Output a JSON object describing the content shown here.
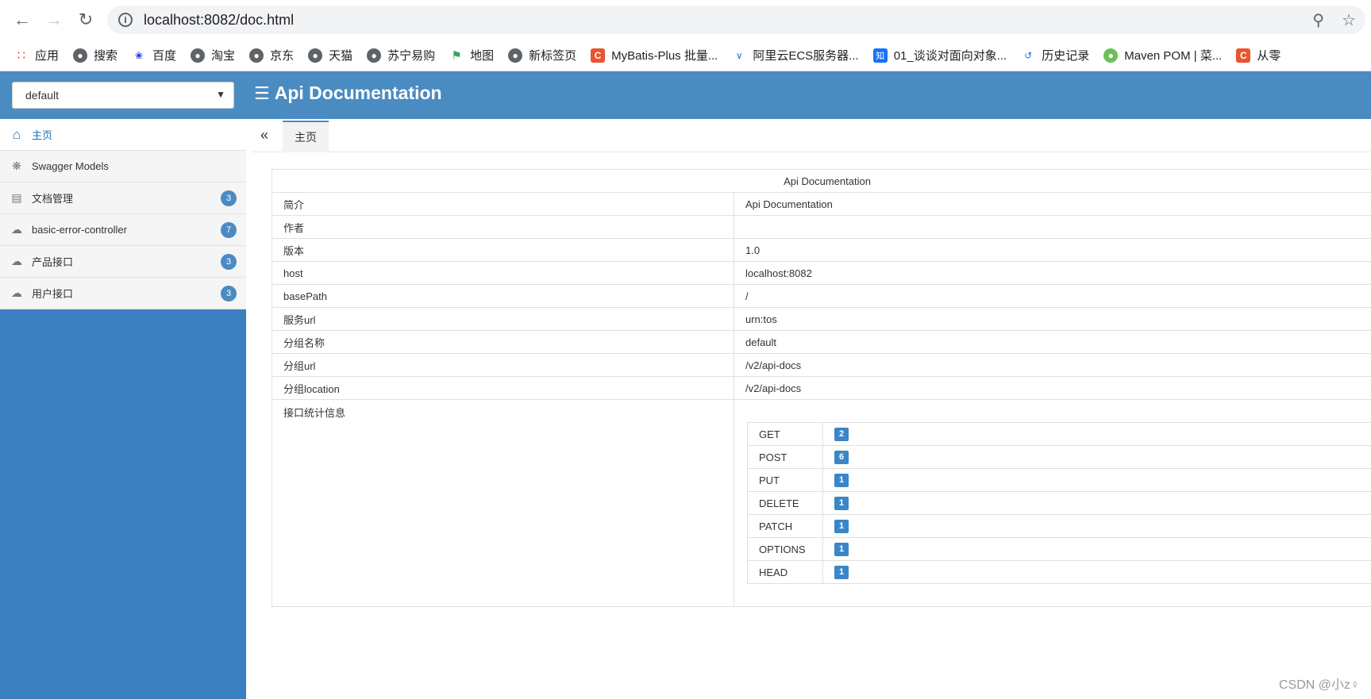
{
  "browser": {
    "url": "localhost:8082/doc.html",
    "bookmarks": [
      {
        "label": "应用",
        "icon": "apps-grid-icon"
      },
      {
        "label": "搜索",
        "icon": "globe-icon"
      },
      {
        "label": "百度",
        "icon": "baidu-paw-icon"
      },
      {
        "label": "淘宝",
        "icon": "globe-icon"
      },
      {
        "label": "京东",
        "icon": "globe-icon"
      },
      {
        "label": "天猫",
        "icon": "globe-icon"
      },
      {
        "label": "苏宁易购",
        "icon": "globe-icon"
      },
      {
        "label": "地图",
        "icon": "map-pin-icon"
      },
      {
        "label": "新标签页",
        "icon": "globe-icon"
      },
      {
        "label": "MyBatis-Plus 批量...",
        "icon": "csdn-icon"
      },
      {
        "label": "阿里云ECS服务器...",
        "icon": "aliyun-icon"
      },
      {
        "label": "01_谈谈对面向对象...",
        "icon": "zhihu-icon"
      },
      {
        "label": "历史记录",
        "icon": "history-icon"
      },
      {
        "label": "Maven POM | 菜...",
        "icon": "runoob-icon"
      },
      {
        "label": "从零",
        "icon": "csdn-icon"
      }
    ]
  },
  "header": {
    "group_select": "default",
    "title": "Api Documentation"
  },
  "sidebar": {
    "items": [
      {
        "label": "主页",
        "icon": "home-icon",
        "badge": ""
      },
      {
        "label": "Swagger Models",
        "icon": "models-icon",
        "badge": ""
      },
      {
        "label": "文档管理",
        "icon": "doc-manage-icon",
        "badge": "3"
      },
      {
        "label": "basic-error-controller",
        "icon": "cloud-api-icon",
        "badge": "7"
      },
      {
        "label": "产品接口",
        "icon": "cloud-api-icon",
        "badge": "3"
      },
      {
        "label": "用户接口",
        "icon": "cloud-api-icon",
        "badge": "3"
      }
    ]
  },
  "tabs": {
    "collapse_glyph": "«",
    "active": "主页"
  },
  "doc": {
    "title": "Api Documentation",
    "rows": [
      {
        "label": "简介",
        "value": "Api Documentation"
      },
      {
        "label": "作者",
        "value": ""
      },
      {
        "label": "版本",
        "value": "1.0"
      },
      {
        "label": "host",
        "value": "localhost:8082"
      },
      {
        "label": "basePath",
        "value": "/"
      },
      {
        "label": "服务url",
        "value": "urn:tos"
      },
      {
        "label": "分组名称",
        "value": "default"
      },
      {
        "label": "分组url",
        "value": "/v2/api-docs"
      },
      {
        "label": "分组location",
        "value": "/v2/api-docs"
      }
    ],
    "stats_label": "接口统计信息",
    "stats": [
      {
        "method": "GET",
        "count": "2"
      },
      {
        "method": "POST",
        "count": "6"
      },
      {
        "method": "PUT",
        "count": "1"
      },
      {
        "method": "DELETE",
        "count": "1"
      },
      {
        "method": "PATCH",
        "count": "1"
      },
      {
        "method": "OPTIONS",
        "count": "1"
      },
      {
        "method": "HEAD",
        "count": "1"
      }
    ]
  },
  "watermark": "CSDN @小z♀",
  "colors": {
    "header_bg": "#4a8bc2",
    "sidebar_bg": "#3c7fc0",
    "badge_bg": "#3a86c8"
  }
}
